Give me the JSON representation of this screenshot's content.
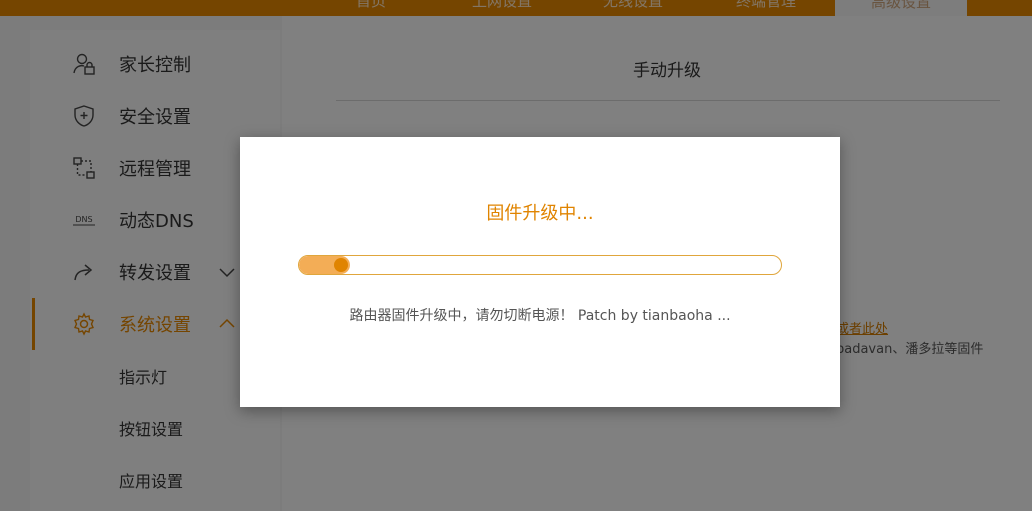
{
  "top_nav": {
    "tabs": [
      {
        "label": "首页"
      },
      {
        "label": "上网设置"
      },
      {
        "label": "无线设置"
      },
      {
        "label": "终端管理"
      },
      {
        "label": "高级设置"
      }
    ]
  },
  "sidebar": {
    "items": [
      {
        "label": "家长控制",
        "icon": "parental-control-icon"
      },
      {
        "label": "安全设置",
        "icon": "shield-icon"
      },
      {
        "label": "远程管理",
        "icon": "remote-management-icon"
      },
      {
        "label": "动态DNS",
        "icon": "dns-icon"
      },
      {
        "label": "转发设置",
        "icon": "forward-icon"
      },
      {
        "label": "系统设置",
        "icon": "gear-icon"
      }
    ],
    "sub_items": [
      {
        "label": "指示灯"
      },
      {
        "label": "按钮设置"
      },
      {
        "label": "应用设置"
      }
    ]
  },
  "content": {
    "title": "手动升级",
    "link_fragment": "或者此处",
    "note_fragment": "​padavan、潘多拉等固件"
  },
  "modal": {
    "title": "固件升级中...",
    "progress": 0.08,
    "message": "路由器固件升级中，请勿切断电源！ Patch by tianbaoha ..."
  },
  "colors": {
    "accent": "#e08400",
    "progress_fill": "#f3ad56",
    "progress_border": "#e0a63c"
  }
}
